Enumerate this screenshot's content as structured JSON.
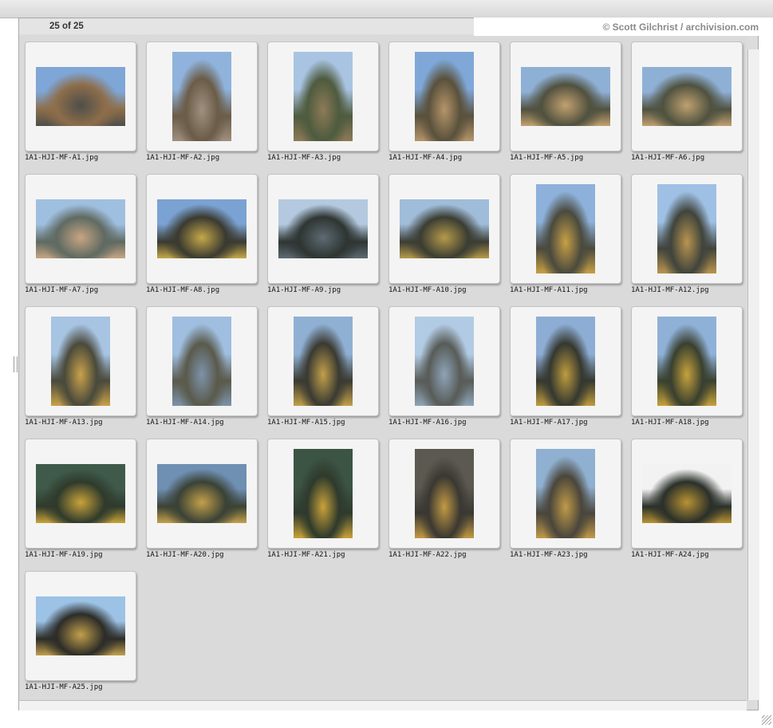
{
  "header": {
    "count": "25 of 25",
    "credit": "© Scott Gilchrist / archivision.com"
  },
  "images": [
    {
      "name": "1A1-HJI-MF-A1.jpg",
      "orientation": "landscape",
      "palette": [
        "#7ea6d6",
        "#8d6d4a",
        "#4e4e4a"
      ]
    },
    {
      "name": "1A1-HJI-MF-A2.jpg",
      "orientation": "portrait",
      "palette": [
        "#8fb3dc",
        "#6b5c48",
        "#a09080"
      ]
    },
    {
      "name": "1A1-HJI-MF-A3.jpg",
      "orientation": "portrait",
      "palette": [
        "#a9c4e2",
        "#4e5b3e",
        "#8d7a58"
      ]
    },
    {
      "name": "1A1-HJI-MF-A4.jpg",
      "orientation": "portrait",
      "palette": [
        "#7fa8d9",
        "#5a513c",
        "#b5956a"
      ]
    },
    {
      "name": "1A1-HJI-MF-A5.jpg",
      "orientation": "landscape",
      "palette": [
        "#8fb0d5",
        "#50513f",
        "#c3a16f"
      ]
    },
    {
      "name": "1A1-HJI-MF-A6.jpg",
      "orientation": "landscape",
      "palette": [
        "#8fb0d5",
        "#4f5240",
        "#c0a070"
      ]
    },
    {
      "name": "1A1-HJI-MF-A7.jpg",
      "orientation": "landscape",
      "palette": [
        "#9fbfe0",
        "#5f6a62",
        "#c8a582"
      ]
    },
    {
      "name": "1A1-HJI-MF-A8.jpg",
      "orientation": "landscape",
      "palette": [
        "#7aa2d2",
        "#3a3a30",
        "#c5a84a"
      ]
    },
    {
      "name": "1A1-HJI-MF-A9.jpg",
      "orientation": "landscape",
      "palette": [
        "#b4c9df",
        "#2e3532",
        "#5d6a72"
      ]
    },
    {
      "name": "1A1-HJI-MF-A10.jpg",
      "orientation": "landscape",
      "palette": [
        "#9fbcd9",
        "#3b3d33",
        "#b59a4a"
      ]
    },
    {
      "name": "1A1-HJI-MF-A11.jpg",
      "orientation": "portrait",
      "palette": [
        "#8db1da",
        "#4a4a3e",
        "#c8a045"
      ]
    },
    {
      "name": "1A1-HJI-MF-A12.jpg",
      "orientation": "portrait",
      "palette": [
        "#9ec0e4",
        "#40443c",
        "#b9954e"
      ]
    },
    {
      "name": "1A1-HJI-MF-A13.jpg",
      "orientation": "portrait",
      "palette": [
        "#a7c4e3",
        "#4a4a3c",
        "#c9a24a"
      ]
    },
    {
      "name": "1A1-HJI-MF-A14.jpg",
      "orientation": "portrait",
      "palette": [
        "#9fbee0",
        "#5a5a4c",
        "#7d93aa"
      ]
    },
    {
      "name": "1A1-HJI-MF-A15.jpg",
      "orientation": "portrait",
      "palette": [
        "#8fb0d3",
        "#3a3a32",
        "#c2a04c"
      ]
    },
    {
      "name": "1A1-HJI-MF-A16.jpg",
      "orientation": "portrait",
      "palette": [
        "#b2cbe4",
        "#585c58",
        "#8ea4b8"
      ]
    },
    {
      "name": "1A1-HJI-MF-A17.jpg",
      "orientation": "portrait",
      "palette": [
        "#8dadd4",
        "#353830",
        "#bf9c3e"
      ]
    },
    {
      "name": "1A1-HJI-MF-A18.jpg",
      "orientation": "portrait",
      "palette": [
        "#8fb1d8",
        "#39402f",
        "#c7a23c"
      ]
    },
    {
      "name": "1A1-HJI-MF-A19.jpg",
      "orientation": "landscape",
      "palette": [
        "#3f5a4a",
        "#2f3a2c",
        "#c9a33a"
      ]
    },
    {
      "name": "1A1-HJI-MF-A20.jpg",
      "orientation": "landscape",
      "palette": [
        "#6f8fb3",
        "#3a4236",
        "#c4a04a"
      ]
    },
    {
      "name": "1A1-HJI-MF-A21.jpg",
      "orientation": "portrait",
      "palette": [
        "#3c5444",
        "#2e3a2c",
        "#c9a23a"
      ]
    },
    {
      "name": "1A1-HJI-MF-A22.jpg",
      "orientation": "portrait",
      "palette": [
        "#5c5a50",
        "#3a3832",
        "#c39a44"
      ]
    },
    {
      "name": "1A1-HJI-MF-A23.jpg",
      "orientation": "portrait",
      "palette": [
        "#8fb0d0",
        "#4a463c",
        "#c09a48"
      ]
    },
    {
      "name": "1A1-HJI-MF-A24.jpg",
      "orientation": "landscape",
      "palette": [
        "#f2f2f2",
        "#2a302a",
        "#b89234"
      ]
    },
    {
      "name": "1A1-HJI-MF-A25.jpg",
      "orientation": "landscape",
      "palette": [
        "#9cc2e6",
        "#2c2c28",
        "#c2a04c"
      ]
    }
  ]
}
